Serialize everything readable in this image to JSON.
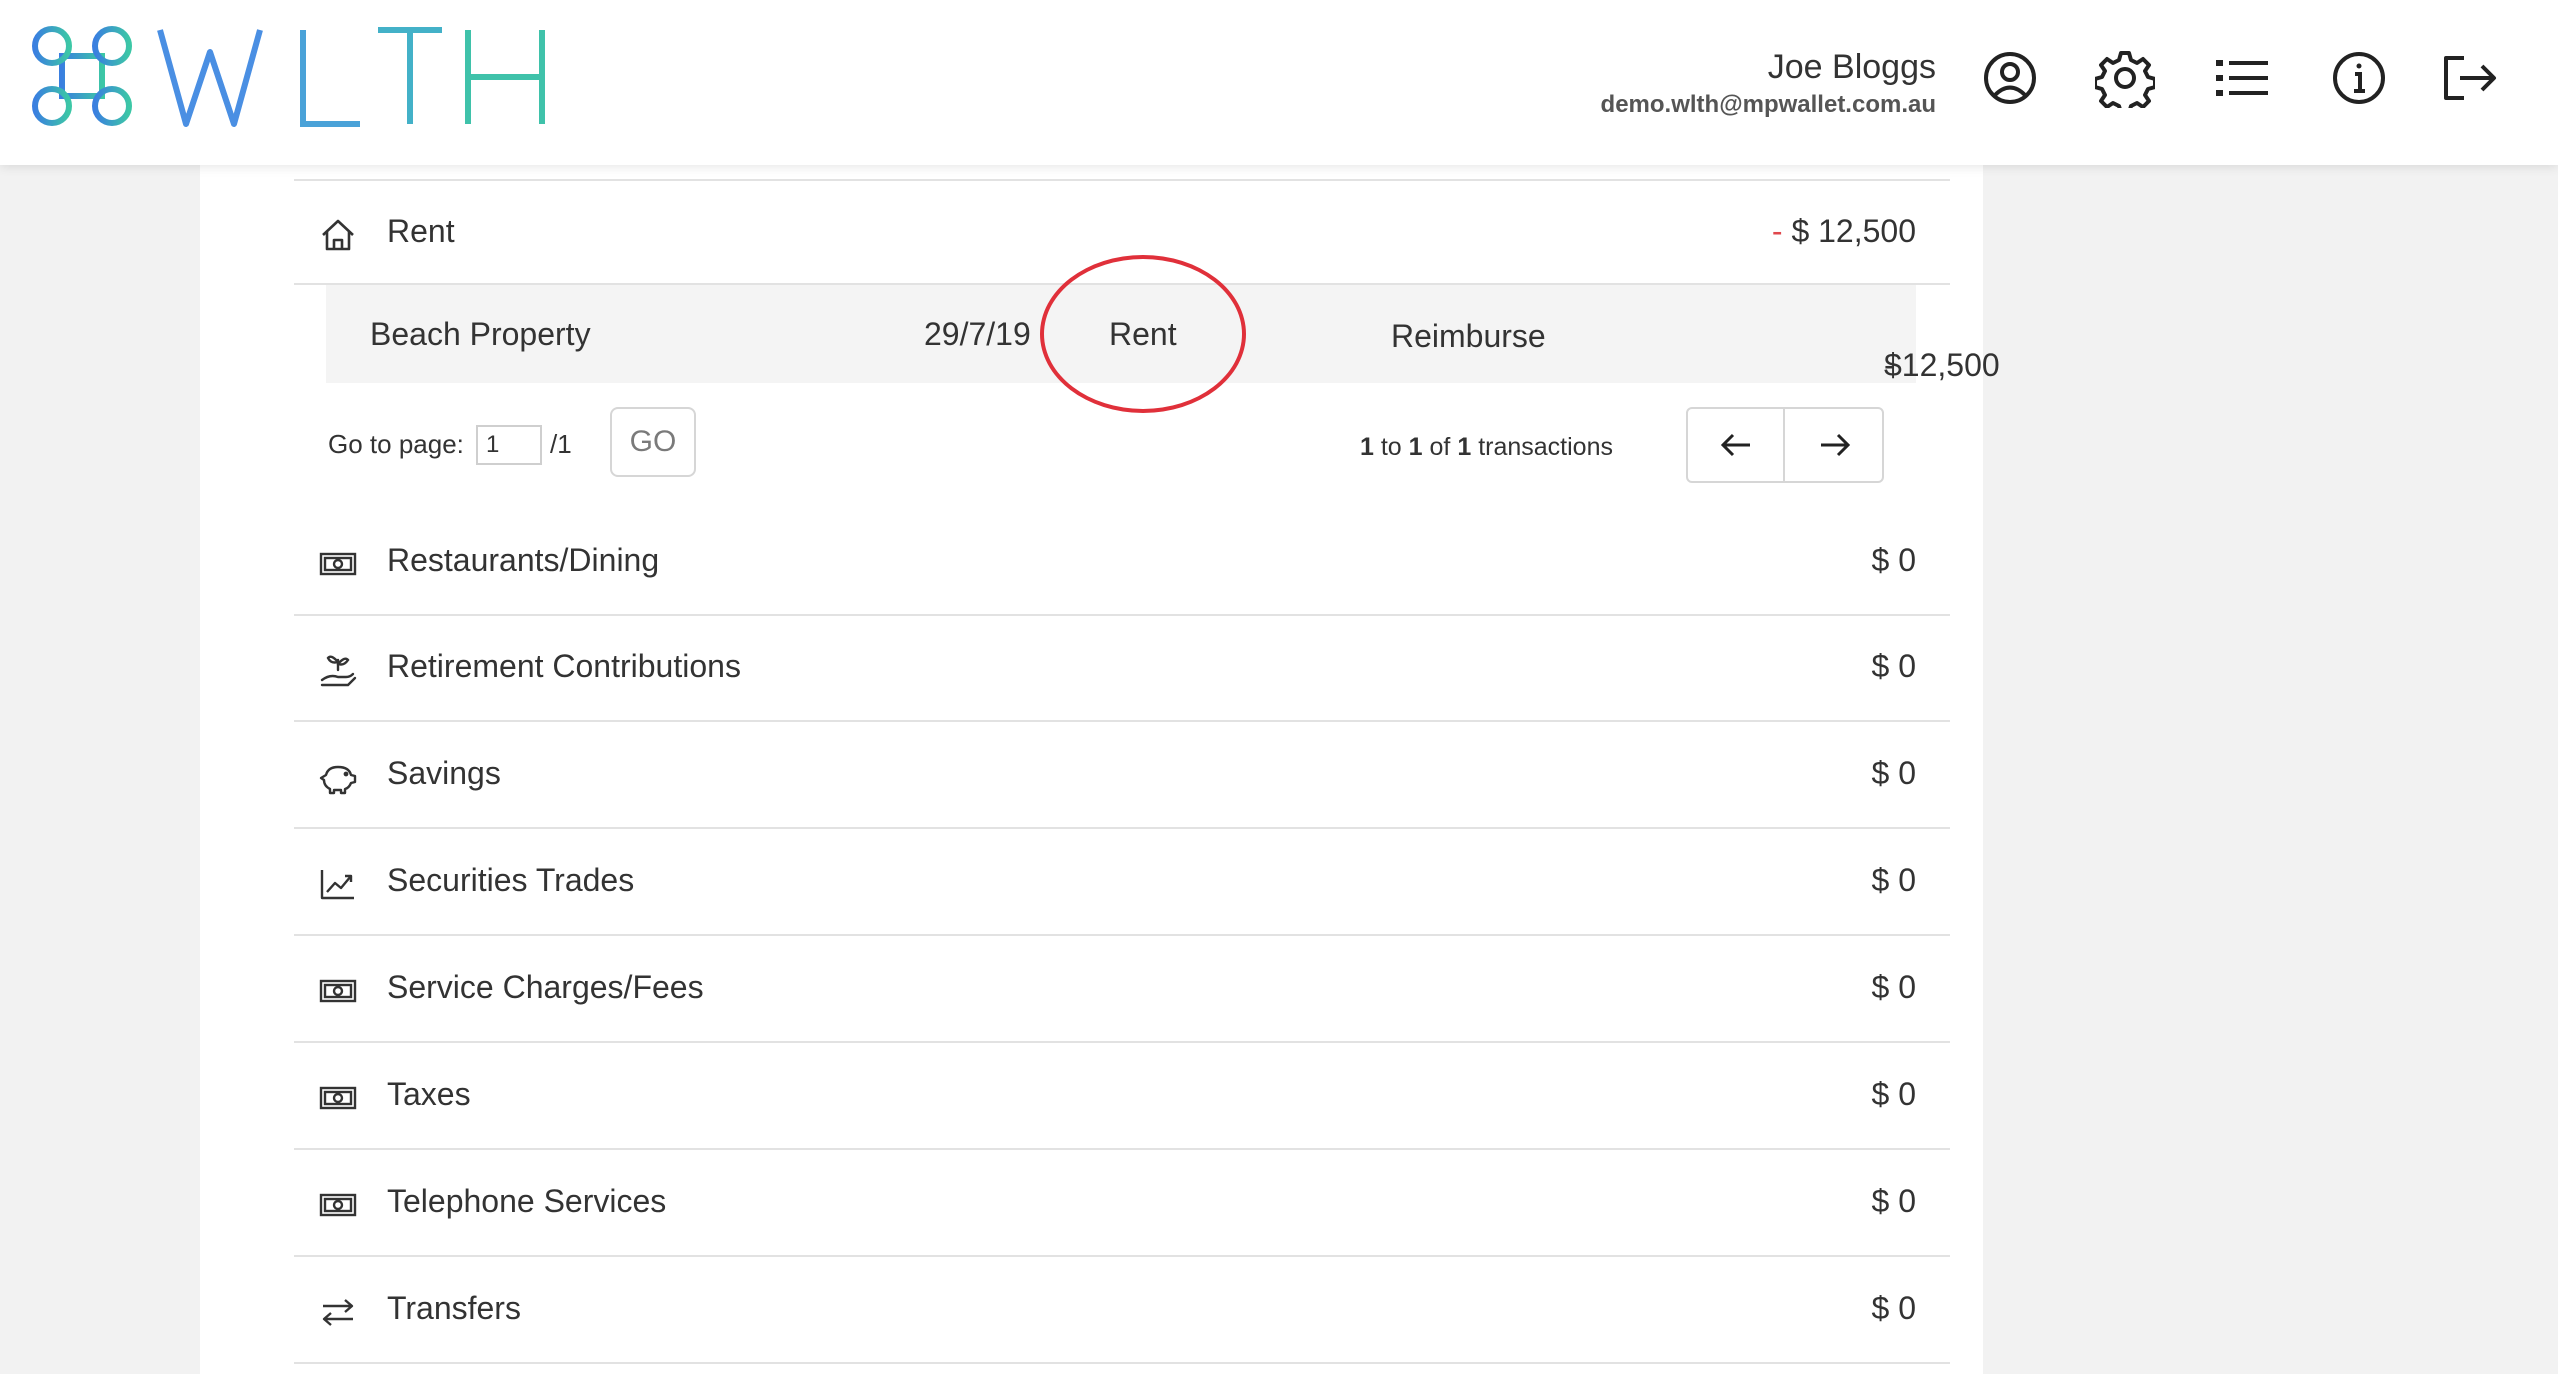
{
  "header": {
    "logo_text": "WLTH",
    "user_name": "Joe Bloggs",
    "user_email": "demo.wlth@mpwallet.com.au",
    "icons": [
      "user-circle-icon",
      "gear-icon",
      "list-icon",
      "info-icon",
      "logout-icon"
    ]
  },
  "expanded_category": {
    "icon": "home-icon",
    "label": "Rent",
    "amount_sign": "-",
    "amount": "$ 12,500"
  },
  "transaction": {
    "description": "Beach Property",
    "date": "29/7/19",
    "category": "Rent",
    "action": "Reimburse",
    "amount_sign": "-",
    "amount": "$12,500"
  },
  "pagination": {
    "goto_label": "Go to page:",
    "current_page": "1",
    "total_pages": "/1",
    "go_label": "GO",
    "range_from": "1",
    "range_to_word": "to",
    "range_to": "1",
    "of_word": "of",
    "total": "1",
    "items_word": "transactions"
  },
  "categories": [
    {
      "icon": "banknote-icon",
      "label": "Restaurants/Dining",
      "amount": "$ 0"
    },
    {
      "icon": "hand-plant-icon",
      "label": "Retirement Contributions",
      "amount": "$ 0"
    },
    {
      "icon": "piggy-bank-icon",
      "label": "Savings",
      "amount": "$ 0"
    },
    {
      "icon": "trend-chart-icon",
      "label": "Securities Trades",
      "amount": "$ 0"
    },
    {
      "icon": "banknote-icon",
      "label": "Service Charges/Fees",
      "amount": "$ 0"
    },
    {
      "icon": "banknote-icon",
      "label": "Taxes",
      "amount": "$ 0"
    },
    {
      "icon": "banknote-icon",
      "label": "Telephone Services",
      "amount": "$ 0"
    },
    {
      "icon": "swap-arrows-icon",
      "label": "Transfers",
      "amount": "$ 0"
    }
  ],
  "colors": {
    "accent_red": "#e0303a",
    "logo_blue": "#4a90e2",
    "logo_teal": "#3fc6a8"
  }
}
